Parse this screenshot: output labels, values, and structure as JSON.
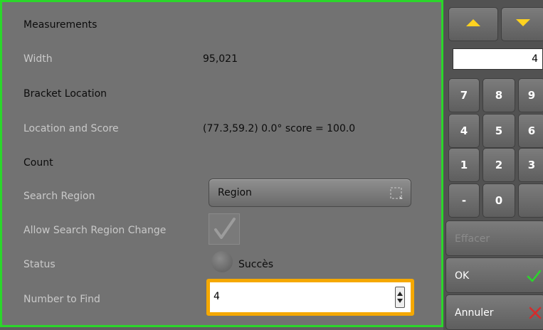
{
  "properties": {
    "measurements_header": "Measurements",
    "width_label": "Width",
    "width_value": "95,021",
    "bracket_header": "Bracket Location",
    "location_label": "Location and Score",
    "location_value": "(77.3,59.2) 0.0° score = 100.0",
    "count_header": "Count",
    "search_region_label": "Search Region",
    "search_region_button": "Region",
    "allow_change_label": "Allow Search Region Change",
    "allow_change_checked": true,
    "status_label": "Status",
    "status_value": "Succès",
    "number_to_find_label": "Number to Find",
    "number_to_find_value": "4"
  },
  "keypad": {
    "display": "4",
    "keys": [
      "7",
      "8",
      "9",
      "4",
      "5",
      "6",
      "1",
      "2",
      "3",
      "-",
      "0"
    ],
    "clear_label": "Effacer",
    "ok_label": "OK",
    "cancel_label": "Annuler"
  },
  "colors": {
    "panel_border": "#2bd62b",
    "focus_border": "#f5a800",
    "ok_check": "#2bd62b",
    "cancel_x": "#d62b2b",
    "arrow": "#ffd21f"
  }
}
